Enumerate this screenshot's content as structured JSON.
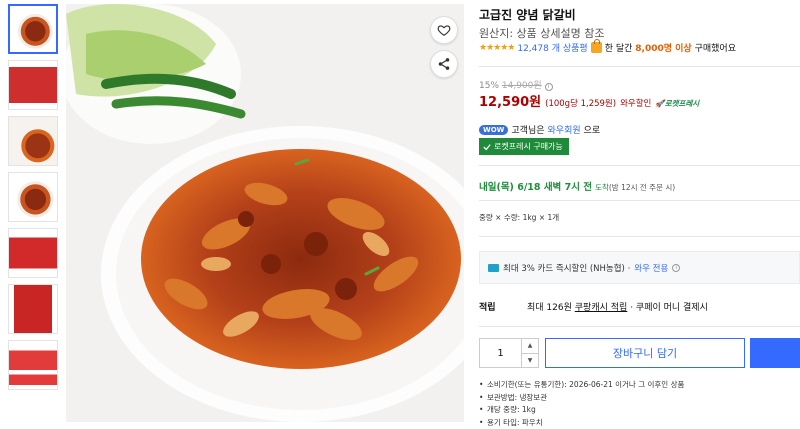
{
  "product": {
    "title": "고급진 양념 닭갈비",
    "origin": "원산지: 상품 상세설명 참조",
    "stars": "★★★★★",
    "review_count": "12,478 개 상품평",
    "buyers_prefix": "한 달간",
    "buyers_count": "8,000명 이상",
    "buyers_suffix": "구매했어요",
    "rating_value": 4.5
  },
  "price": {
    "discount_rate": "15%",
    "original_price": "14,900원",
    "sale_price": "12,590원",
    "unit_price": "(100g당 1,259원)",
    "wow_sale": "와우할인",
    "rocket_fresh": "로켓프레시"
  },
  "membership": {
    "wow_badge": "WOW",
    "text_prefix": "고객님은",
    "wow_member_link": "와우회원",
    "text_suffix": "으로",
    "rocket_fresh_buy": "로켓프레시 구매가능"
  },
  "delivery": {
    "date": "내일(목) 6/18 새벽 7시 전",
    "arrival": "도착",
    "note": "(밤 12시 전 주문 시)"
  },
  "option": {
    "quantity_info": "중량 × 수량: 1kg × 1개"
  },
  "card_offer": {
    "text": "최대 3% 카드 즉시할인 (NH농협) ·",
    "wow_only": "와우 전용"
  },
  "reward": {
    "label": "적립",
    "text": "최대 126원",
    "cash_link": "쿠팡캐시 적립",
    "coupay": "· 쿠페이 머니 결제시"
  },
  "purchase": {
    "quantity": "1",
    "cart_button": "장바구니 담기",
    "buy_button": ""
  },
  "details": [
    "소비기한(또는 유통기한): 2026-06-21 이거나 그 이후인 상품",
    "보관방법: 냉장보관",
    "개당 중량: 1kg",
    "용기 타입: 파우치"
  ],
  "icons": {
    "heart": "heart-icon",
    "share": "share-icon",
    "info": "info-icon",
    "card": "card-icon",
    "check": "check-icon"
  },
  "colors": {
    "accent_blue": "#346aff",
    "price_red": "#ae0000",
    "rocket_green": "#1f8b3a",
    "star": "#f59e0b"
  }
}
